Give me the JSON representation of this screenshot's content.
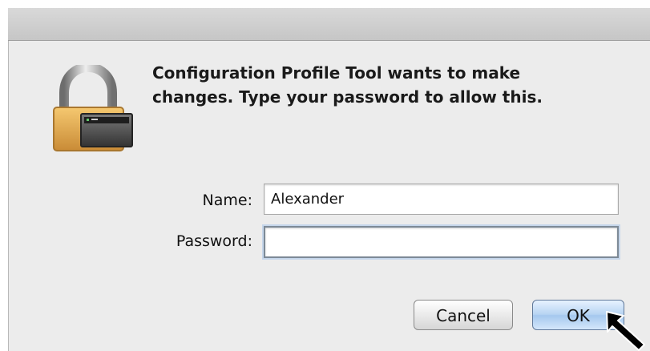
{
  "dialog": {
    "message_line_1": "Configuration Profile Tool wants to make",
    "message_line_2": "changes. Type your password to allow this.",
    "icons": {
      "lock": "lock-icon",
      "cursor": "cursor-icon"
    },
    "fields": {
      "name_label": "Name:",
      "name_value": "Alexander",
      "password_label": "Password:",
      "password_value": ""
    },
    "buttons": {
      "cancel_label": "Cancel",
      "ok_label": "OK"
    }
  }
}
